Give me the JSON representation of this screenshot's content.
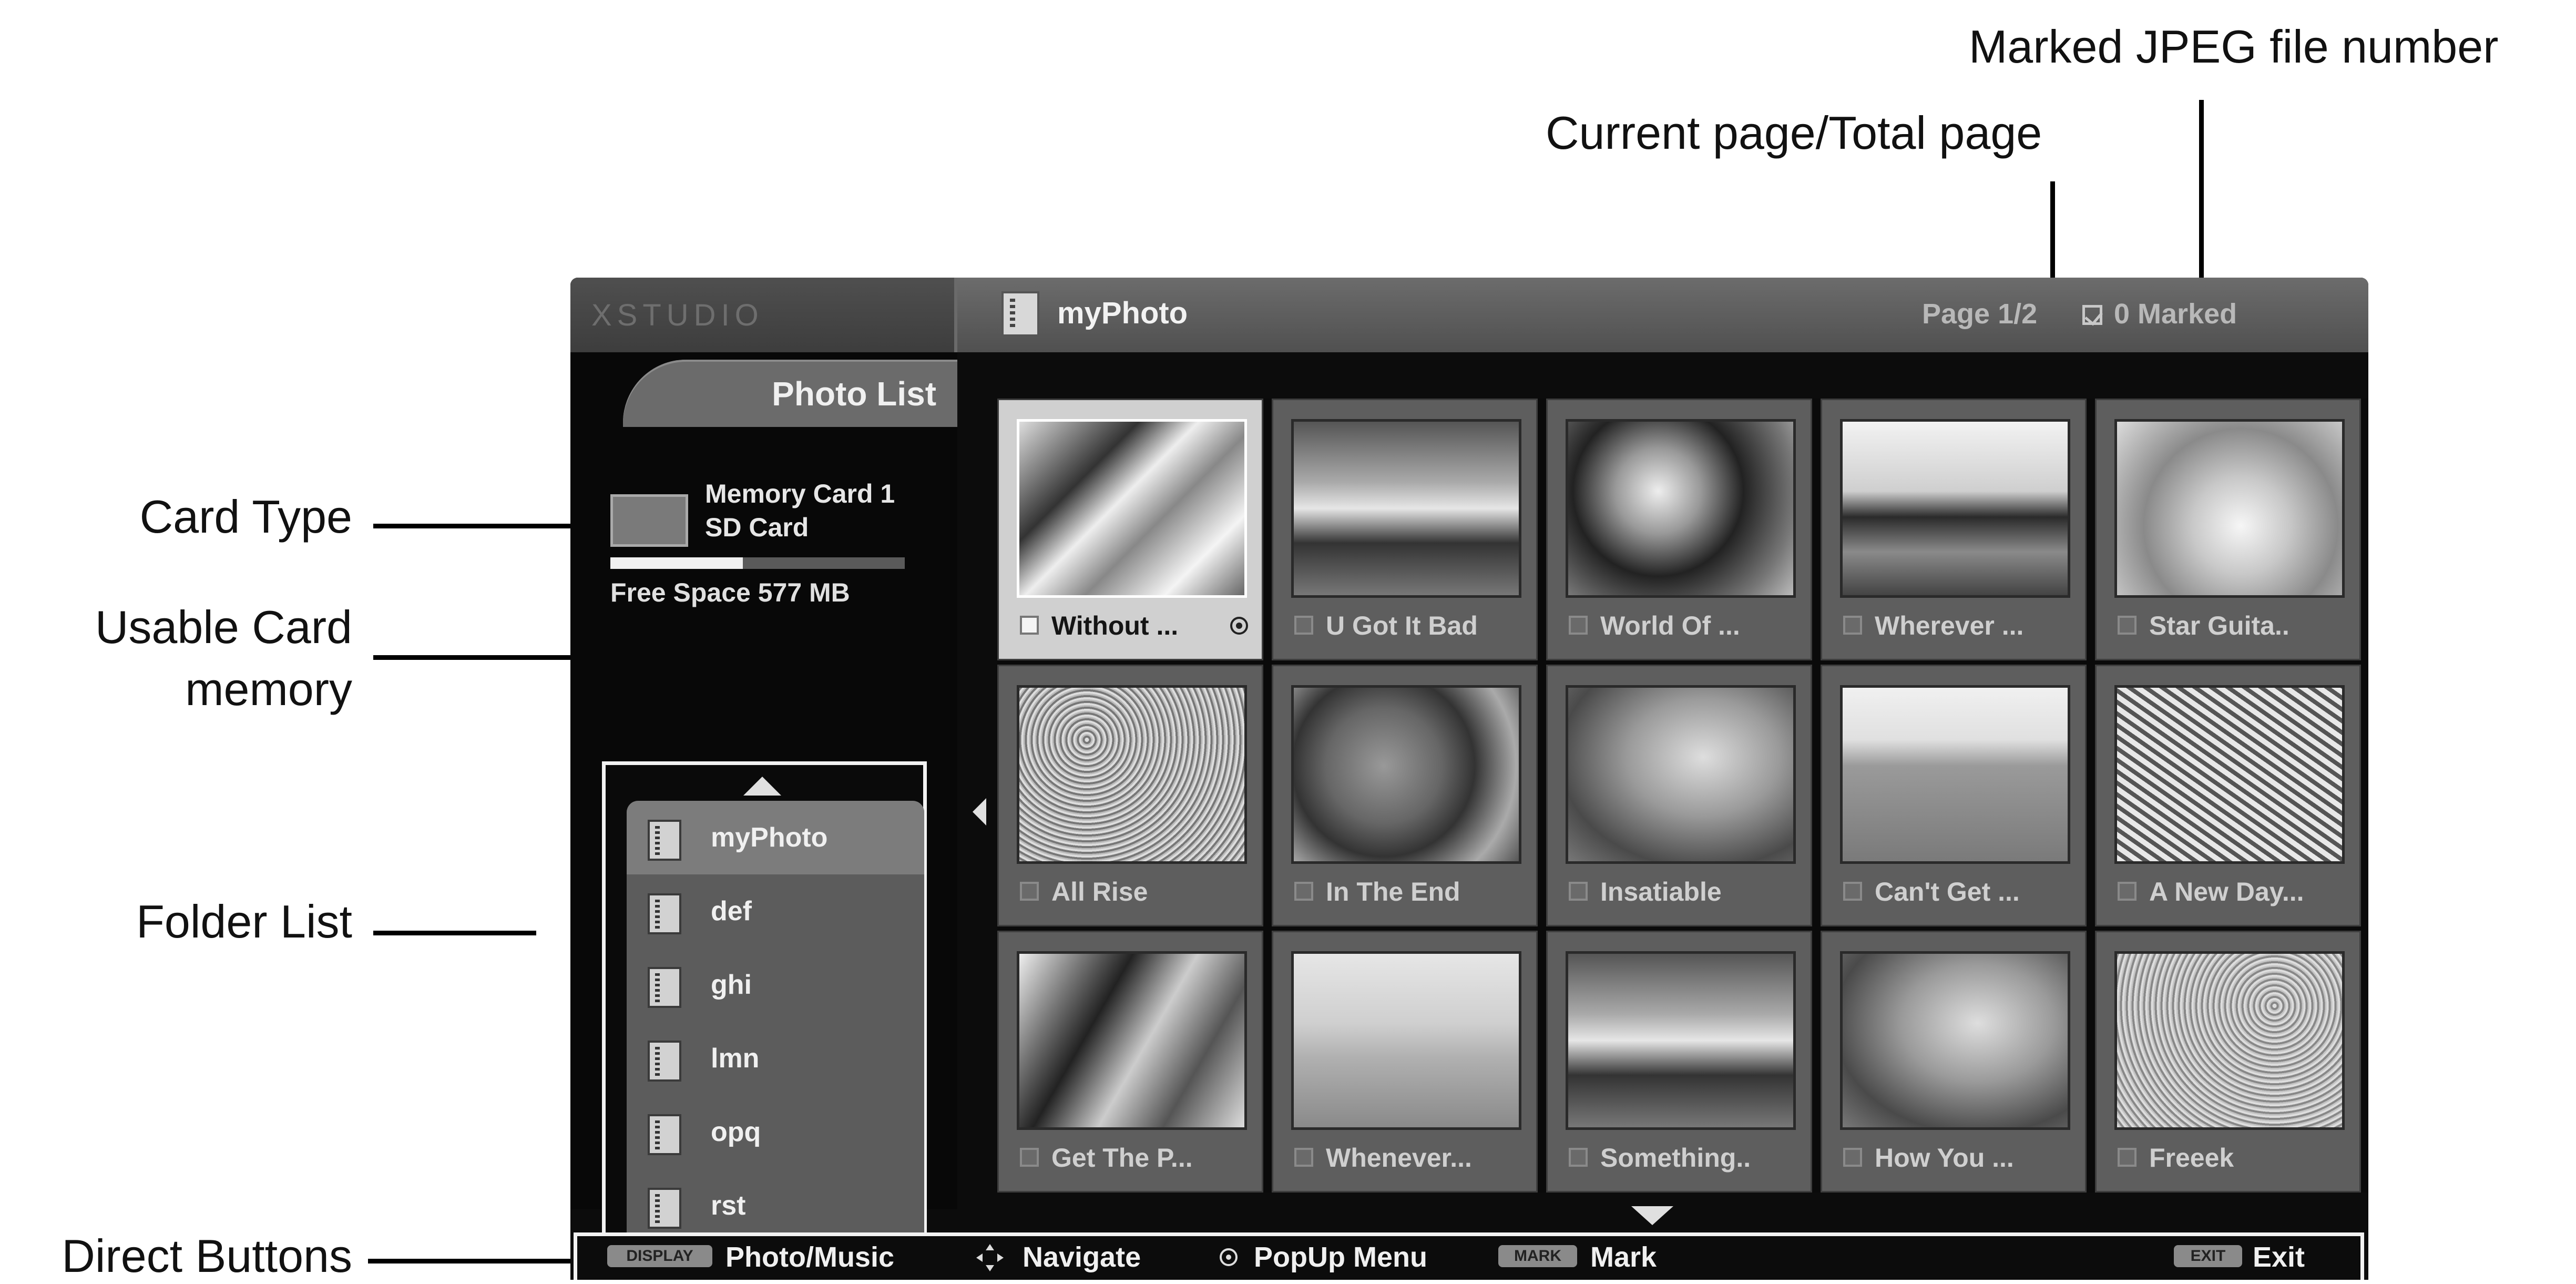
{
  "annotations": {
    "marked_jpeg": "Marked JPEG file number",
    "current_page": "Current page/Total page",
    "card_type": "Card Type",
    "usable_memory_line1": "Usable Card",
    "usable_memory_line2": "memory",
    "folder_list": "Folder List",
    "direct_buttons": "Direct Buttons"
  },
  "screen": {
    "brand": "XSTUDIO",
    "tab": "Photo List",
    "current_folder": "myPhoto",
    "page": "Page 1/2",
    "marked": "0 Marked"
  },
  "card": {
    "name": "Memory Card 1",
    "type": "SD Card",
    "free_space": "Free Space 577 MB",
    "used_fraction": 0.45
  },
  "folders": [
    {
      "label": "myPhoto"
    },
    {
      "label": "def"
    },
    {
      "label": "ghi"
    },
    {
      "label": "lmn"
    },
    {
      "label": "opq"
    },
    {
      "label": "rst"
    }
  ],
  "photos": [
    {
      "label": "Without ..."
    },
    {
      "label": "U Got It Bad"
    },
    {
      "label": "World Of ..."
    },
    {
      "label": "Wherever ..."
    },
    {
      "label": "Star Guita.."
    },
    {
      "label": "All Rise"
    },
    {
      "label": "In The End"
    },
    {
      "label": "Insatiable"
    },
    {
      "label": "Can't Get ..."
    },
    {
      "label": "A New Day..."
    },
    {
      "label": "Get The P..."
    },
    {
      "label": "Whenever..."
    },
    {
      "label": "Something.."
    },
    {
      "label": "How You ..."
    },
    {
      "label": "Freeek"
    }
  ],
  "bottom_bar": {
    "key_photo_music": "DISPLAY",
    "photo_music": "Photo/Music",
    "navigate": "Navigate",
    "popup": "PopUp Menu",
    "key_mark": "MARK",
    "mark": "Mark",
    "key_exit": "EXIT",
    "exit": "Exit"
  },
  "colors": {
    "screen_bg": "#0c0c0c",
    "cell_bg": "#5e5e5e",
    "cell_selected": "#d0d0d0",
    "panel": "#5c5c5c"
  },
  "icons": {
    "title": "folder-icon",
    "card": "memory-card-icon",
    "navigate": "navigate-arrows-icon",
    "popup": "popup-menu-icon"
  }
}
